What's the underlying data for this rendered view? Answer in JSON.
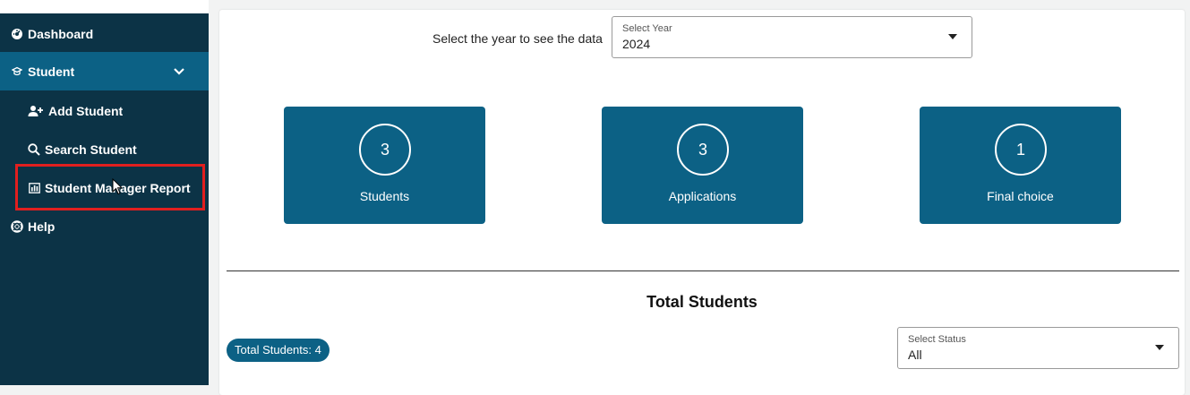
{
  "sidebar": {
    "items": [
      {
        "label": "Dashboard",
        "icon": "dashboard-icon"
      },
      {
        "label": "Student",
        "icon": "student-cap-icon"
      },
      {
        "label": "Add Student",
        "icon": "add-user-icon"
      },
      {
        "label": "Search Student",
        "icon": "search-icon"
      },
      {
        "label": "Student Manager Report",
        "icon": "bar-chart-icon"
      },
      {
        "label": "Help",
        "icon": "lifebuoy-icon"
      }
    ],
    "active_color": "#0c6185",
    "bg_color": "#0c3346"
  },
  "main": {
    "year_prompt": "Select the year to see the data",
    "year_select": {
      "label": "Select Year",
      "value": "2024"
    },
    "cards": [
      {
        "value": "3",
        "label": "Students"
      },
      {
        "value": "3",
        "label": "Applications"
      },
      {
        "value": "1",
        "label": "Final choice"
      }
    ],
    "section_title": "Total Students",
    "total_badge": "Total Students: 4",
    "status_select": {
      "label": "Select Status",
      "value": "All"
    },
    "accent_color": "#0c6185"
  }
}
